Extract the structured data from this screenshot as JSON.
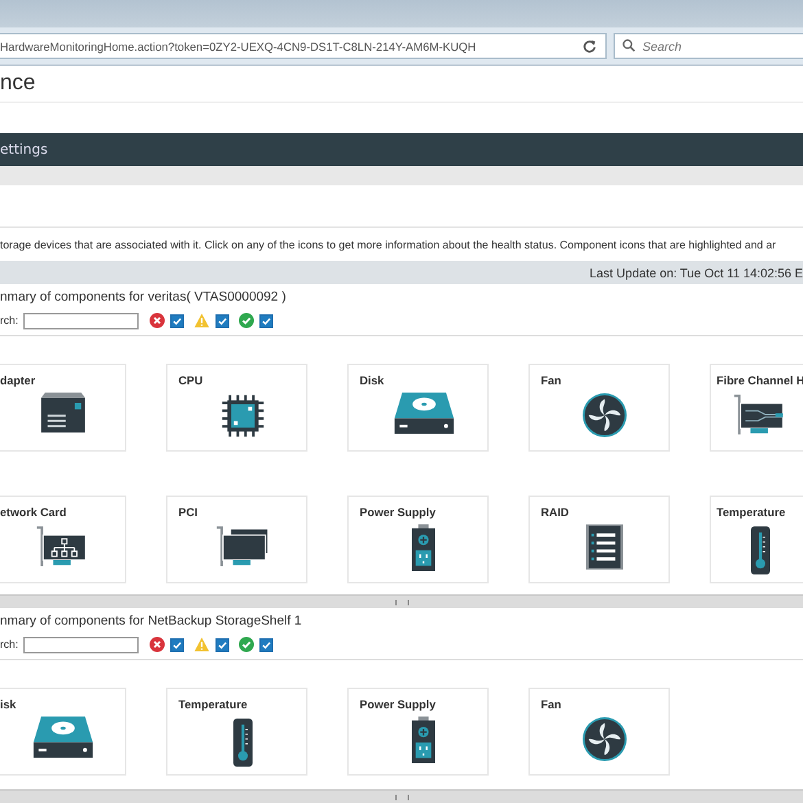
{
  "browser": {
    "url": "HardwareMonitoringHome.action?token=0ZY2-UEXQ-4CN9-DS1T-C8LN-214Y-AM6M-KUQH",
    "search_placeholder": "Search"
  },
  "page_title": "nce",
  "nav_bar": {
    "label": "ettings"
  },
  "description": "torage devices that are associated with it. Click on any of the icons to get more information about the health status. Component icons that are highlighted and ar",
  "last_update": "Last Update on: Tue Oct 11 14:02:56 E",
  "sections": [
    {
      "title": "nmary of components for veritas( VTAS0000092 )",
      "search_label": "rch:",
      "filters": [
        {
          "kind": "error",
          "checked": true
        },
        {
          "kind": "warning",
          "checked": true
        },
        {
          "kind": "ok",
          "checked": true
        }
      ],
      "components": [
        {
          "label": "dapter",
          "kind": "adapter"
        },
        {
          "label": "CPU",
          "kind": "cpu"
        },
        {
          "label": "Disk",
          "kind": "disk"
        },
        {
          "label": "Fan",
          "kind": "fan"
        },
        {
          "label": "Fibre Channel H",
          "kind": "fibre"
        },
        {
          "label": "etwork Card",
          "kind": "network"
        },
        {
          "label": "PCI",
          "kind": "pci"
        },
        {
          "label": "Power Supply",
          "kind": "power"
        },
        {
          "label": "RAID",
          "kind": "raid"
        },
        {
          "label": "Temperature",
          "kind": "temperature"
        }
      ]
    },
    {
      "title": "nmary of components for NetBackup StorageShelf 1",
      "search_label": "rch:",
      "filters": [
        {
          "kind": "error",
          "checked": true
        },
        {
          "kind": "warning",
          "checked": true
        },
        {
          "kind": "ok",
          "checked": true
        }
      ],
      "components": [
        {
          "label": "isk",
          "kind": "disk"
        },
        {
          "label": "Temperature",
          "kind": "temperature"
        },
        {
          "label": "Power Supply",
          "kind": "power"
        },
        {
          "label": "Fan",
          "kind": "fan"
        }
      ]
    }
  ]
}
